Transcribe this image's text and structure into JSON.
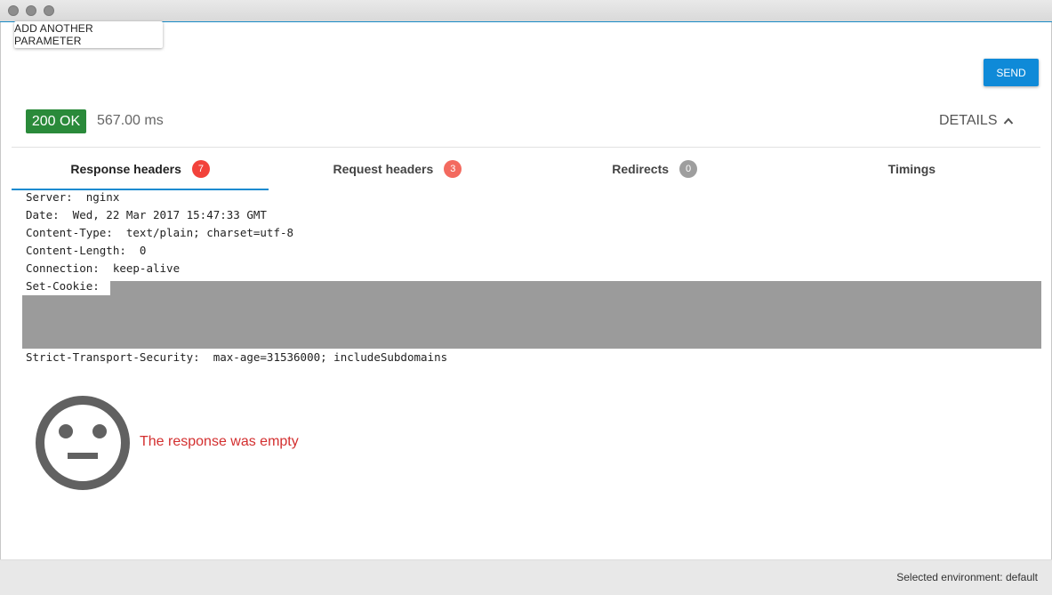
{
  "request": {
    "add_param_label": "ADD ANOTHER PARAMETER",
    "send_label": "SEND"
  },
  "response": {
    "status": "200 OK",
    "time": "567.00 ms",
    "details_label": "DETAILS"
  },
  "tabs": [
    {
      "label": "Response headers",
      "count": "7",
      "active": true
    },
    {
      "label": "Request headers",
      "count": "3",
      "active": false
    },
    {
      "label": "Redirects",
      "count": "0",
      "active": false
    },
    {
      "label": "Timings",
      "count": "",
      "active": false
    }
  ],
  "headers": [
    "Server:  nginx",
    "Date:  Wed, 22 Mar 2017 15:47:33 GMT",
    "Content-Type:  text/plain; charset=utf-8",
    "Content-Length:  0",
    "Connection:  keep-alive"
  ],
  "set_cookie_label": "Set-Cookie:",
  "strict_transport": "Strict-Transport-Security:  max-age=31536000; includeSubdomains",
  "empty_message": "The response was empty",
  "footer": {
    "environment": "Selected environment: default"
  },
  "colors": {
    "status_green": "#2a8a3a",
    "send_blue": "#0f8ad8",
    "badge_red": "#f2423b",
    "badge_gray": "#9e9e9e",
    "error_red": "#d32f2f"
  }
}
